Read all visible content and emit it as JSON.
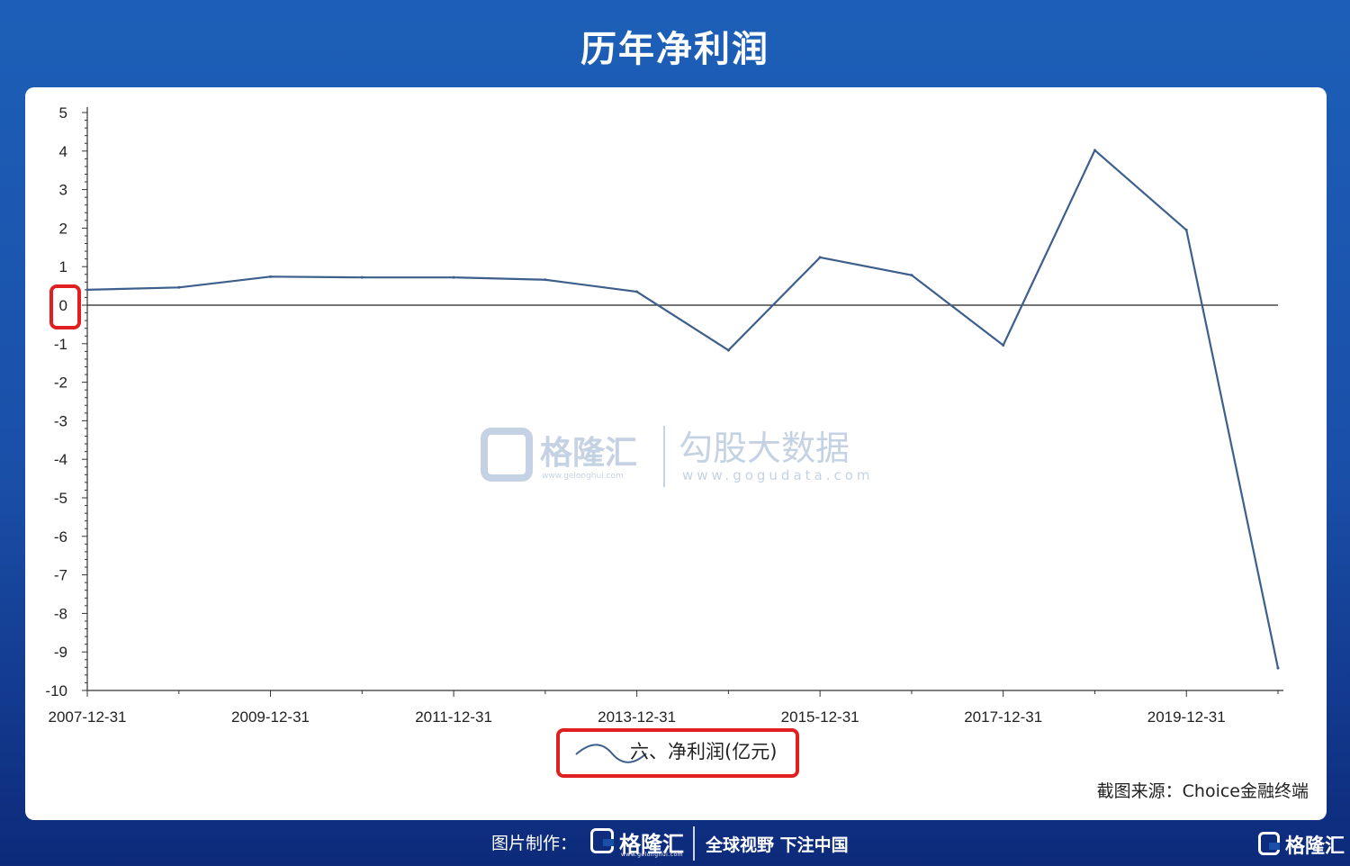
{
  "header": {
    "title": "历年净利润"
  },
  "chart_data": {
    "type": "line",
    "title": "历年净利润",
    "x_tick_labels": [
      "2007-12-31",
      "2009-12-31",
      "2011-12-31",
      "2013-12-31",
      "2015-12-31",
      "2017-12-31",
      "2019-12-31"
    ],
    "y_tick_labels": [
      "5",
      "4",
      "3",
      "2",
      "1",
      "0",
      "-1",
      "-2",
      "-3",
      "-4",
      "-5",
      "-6",
      "-7",
      "-8",
      "-9",
      "-10"
    ],
    "ylim": [
      -10,
      5
    ],
    "x": [
      "2007-12-31",
      "2008-12-31",
      "2009-12-31",
      "2010-12-31",
      "2011-12-31",
      "2012-12-31",
      "2013-12-31",
      "2014-12-31",
      "2015-12-31",
      "2016-12-31",
      "2017-12-31",
      "2018-12-31",
      "2019-12-31",
      "2020-12-31"
    ],
    "series": [
      {
        "name": "六、净利润(亿元)",
        "color": "#3c5f8c",
        "values": [
          0.4,
          0.46,
          0.74,
          0.72,
          0.72,
          0.66,
          0.35,
          -1.17,
          1.24,
          0.78,
          -1.04,
          4.02,
          1.95,
          -9.42
        ]
      }
    ],
    "zero_line": true,
    "legend_position": "bottom-center",
    "highlight_color": "#e02020"
  },
  "watermark": {
    "brand": "格隆汇",
    "brand_url": "www.gelonghui.com",
    "data_brand": "勾股大数据",
    "data_url": "www.gogudata.com"
  },
  "source_note": "截图来源：Choice金融终端",
  "footer": {
    "credit_label": "图片制作：",
    "brand": "格隆汇",
    "brand_url": "www.gelonghui.com",
    "slogan": "全球视野 下注中国",
    "corner_brand": "格隆汇"
  }
}
